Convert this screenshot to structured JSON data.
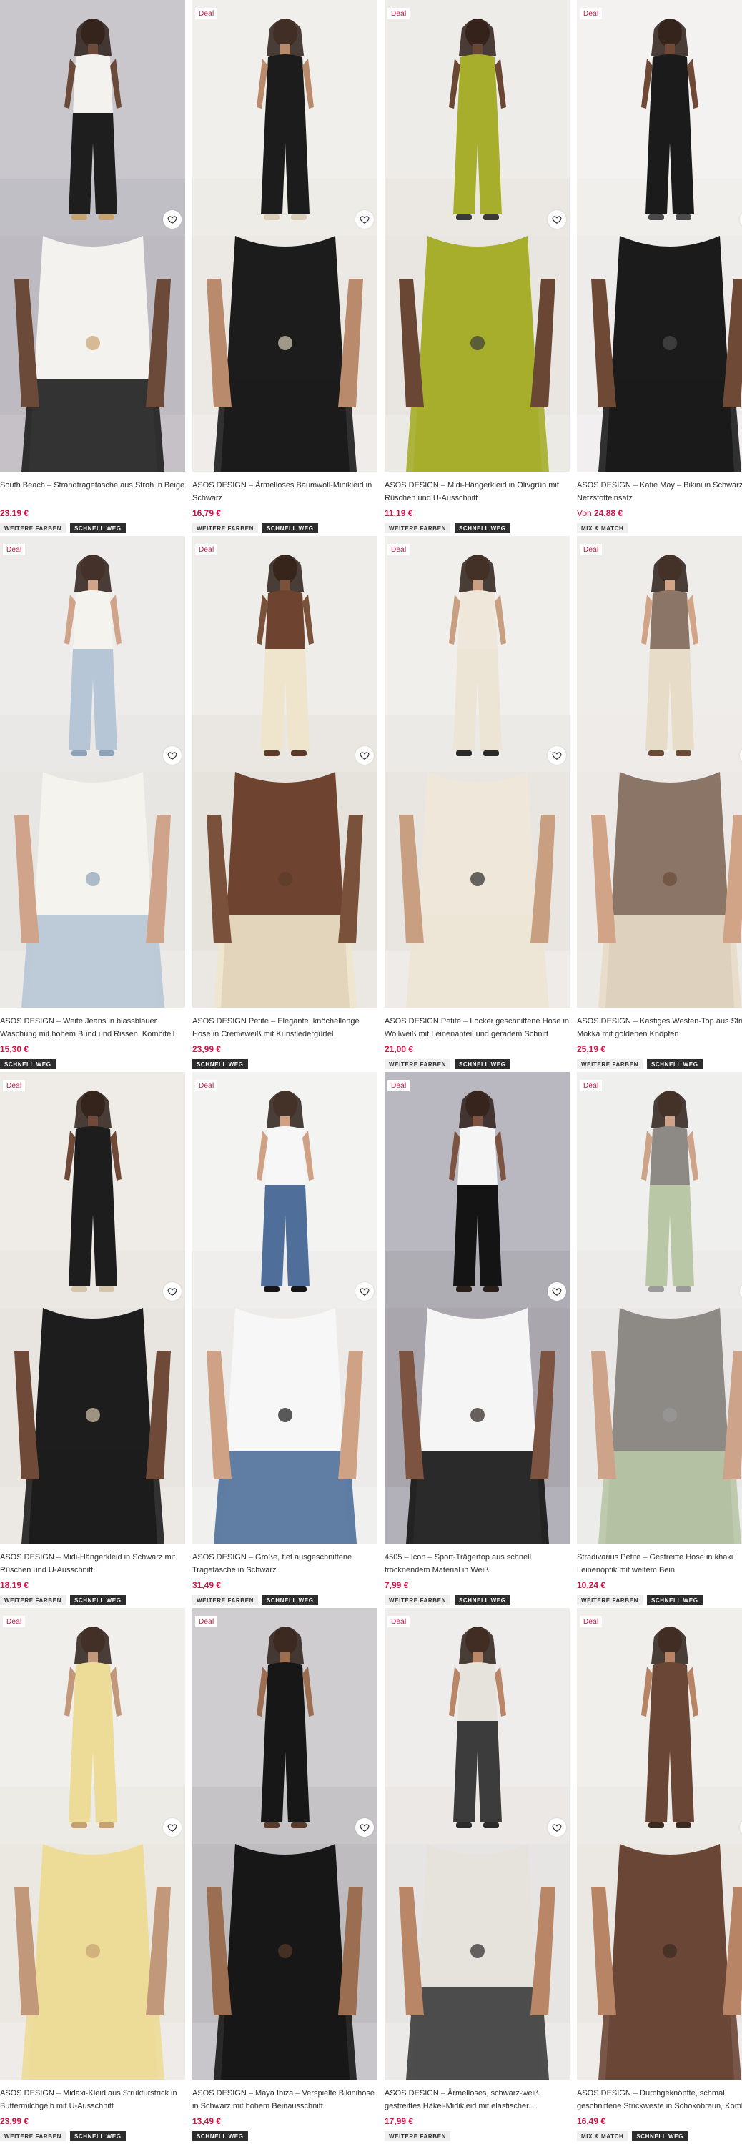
{
  "colors": {
    "accent": "#d01345",
    "tag_dark": "#2d2d2d",
    "tag_light": "#eeeeee"
  },
  "products": [
    {
      "deal": "",
      "title": "South Beach – Strandtragetasche aus Stroh in Beige",
      "price": "23,19 €",
      "tags": [
        "WEITERE FARBEN",
        "SCHNELL WEG"
      ],
      "image_top": "woman in white tank top and black shorts holding straw beach tote",
      "image_bottom": "straw beach tote held beside legs with black shorts",
      "save_icon": "heart-icon"
    },
    {
      "deal": "Deal",
      "title": "ASOS DESIGN – Ärmelloses Baumwoll-Minikleid in Schwarz",
      "price": "16,79 €",
      "tags": [
        "WEITERE FARBEN",
        "SCHNELL WEG"
      ],
      "image_top": "woman in black sleeveless mini dress",
      "image_bottom": "full length black sleeveless mini dress",
      "save_icon": "heart-icon"
    },
    {
      "deal": "Deal",
      "title": "ASOS DESIGN – Midi-Hängerkleid in Olivgrün mit Rüschen und U-Ausschnitt",
      "price": "11,19 €",
      "tags": [
        "WEITERE FARBEN",
        "SCHNELL WEG"
      ],
      "image_top": "woman in olive green midi swing dress",
      "image_bottom": "close up of olive green midi dress",
      "save_icon": "heart-icon"
    },
    {
      "deal": "Deal",
      "title": "ASOS DESIGN – Katie May – Bikini in Schwarz mit Netzstoffeinsatz",
      "price": "24,88 €",
      "price_prefix": "Von",
      "tags": [
        "MIX & MATCH"
      ],
      "image_top": "woman in black mesh bikini",
      "image_bottom": "close up of black mesh bikini top",
      "save_icon": "heart-icon"
    },
    {
      "deal": "Deal",
      "title": "ASOS DESIGN – Weite Jeans in blassblauer Waschung mit hohem Bund und Rissen, Kombiteil",
      "price": "15,30 €",
      "tags": [
        "SCHNELL WEG"
      ],
      "image_top": "woman in light blue wide jeans and denim jacket",
      "image_bottom": "light blue wide leg jeans with white top",
      "save_icon": "heart-icon"
    },
    {
      "deal": "Deal",
      "title": "ASOS DESIGN Petite – Elegante, knöchellange Hose in Cremeweiß mit Kunstledergürtel",
      "price": "23,99 €",
      "tags": [
        "SCHNELL WEG"
      ],
      "image_top": "woman in brown lace cami and cream trousers",
      "image_bottom": "close up of brown cami and cream trousers with belt",
      "save_icon": "heart-icon"
    },
    {
      "deal": "Deal",
      "title": "ASOS DESIGN Petite – Locker geschnittene Hose in Wollweiß mit Leinenanteil und geradem Schnitt",
      "price": "21,00 €",
      "tags": [
        "WEITERE FARBEN",
        "SCHNELL WEG"
      ],
      "image_top": "woman in off-white relaxed trousers",
      "image_bottom": "off-white linen trousers full length",
      "save_icon": "heart-icon"
    },
    {
      "deal": "Deal",
      "title": "ASOS DESIGN – Kastiges Westen-Top aus Strick in Mokka mit goldenen Knöpfen",
      "price": "25,19 €",
      "tags": [
        "WEITERE FARBEN",
        "SCHNELL WEG"
      ],
      "image_top": "woman in mocha knitted waistcoat top and shorts",
      "image_bottom": "mocha knitted waistcoat with shorts full length",
      "save_icon": "heart-icon"
    },
    {
      "deal": "Deal",
      "title": "ASOS DESIGN – Midi-Hängerkleid in Schwarz mit Rüschen und U-Ausschnitt",
      "price": "18,19 €",
      "tags": [
        "WEITERE FARBEN",
        "SCHNELL WEG"
      ],
      "image_top": "woman in black midi swing dress",
      "image_bottom": "woman sitting in black midi dress",
      "save_icon": "heart-icon"
    },
    {
      "deal": "Deal",
      "title": "ASOS DESIGN – Große, tief ausgeschnittene Tragetasche in Schwarz",
      "price": "31,49 €",
      "tags": [
        "WEITERE FARBEN",
        "SCHNELL WEG"
      ],
      "image_top": "woman in jeans holding large black tote bag",
      "image_bottom": "close up of black leather tote handles",
      "save_icon": "heart-icon"
    },
    {
      "deal": "Deal",
      "title": "4505 – Icon – Sport-Trägertop aus schnell trocknendem Material in Weiß",
      "price": "7,99 €",
      "tags": [
        "WEITERE FARBEN",
        "SCHNELL WEG"
      ],
      "image_top": "woman in white sport tank top and black shorts",
      "image_bottom": "back view of white racer back tank",
      "save_icon": "heart-icon"
    },
    {
      "deal": "Deal",
      "title": "Stradivarius Petite – Gestreifte Hose in khaki Leinenoptik mit weitem Bein",
      "price": "10,24 €",
      "tags": [
        "WEITERE FARBEN",
        "SCHNELL WEG"
      ],
      "image_top": "woman in khaki wide leg trousers",
      "image_bottom": "khaki wide leg trousers with grey top",
      "save_icon": "heart-icon"
    },
    {
      "deal": "Deal",
      "title": "ASOS DESIGN – Midaxi-Kleid aus Strukturstrick in Buttermilchgelb mit U-Ausschnitt",
      "price": "23,99 €",
      "tags": [
        "WEITERE FARBEN",
        "SCHNELL WEG"
      ],
      "image_top": "woman in butter yellow knit midaxi dress",
      "image_bottom": "woman sitting in butter yellow knit dress",
      "save_icon": "heart-icon"
    },
    {
      "deal": "Deal",
      "title": "ASOS DESIGN – Maya Ibiza – Verspielte Bikinihose in Schwarz mit hohem Beinausschnitt",
      "price": "13,49 €",
      "tags": [
        "SCHNELL WEG"
      ],
      "image_top": "woman in black bikini",
      "image_bottom": "back view of black bikini bottoms",
      "save_icon": "heart-icon"
    },
    {
      "deal": "Deal",
      "title": "ASOS DESIGN – Ärmelloses, schwarz-weiß gestreiftes Häkel-Midikleid mit elastischer...",
      "price": "17,99 €",
      "tags": [
        "WEITERE FARBEN"
      ],
      "image_top": "woman in black and white striped crochet midi dress",
      "image_bottom": "back view of striped crochet dress",
      "save_icon": "heart-icon"
    },
    {
      "deal": "Deal",
      "title": "ASOS DESIGN – Durchgeknöpfte, schmal geschnittene Strickweste in Schokobraun, Kombiteil",
      "price": "16,49 €",
      "tags": [
        "MIX & MATCH",
        "SCHNELL WEG"
      ],
      "image_top": "woman in chocolate brown knitted waistcoat",
      "image_bottom": "brown knitted waistcoat and trousers full length",
      "save_icon": "heart-icon"
    }
  ]
}
